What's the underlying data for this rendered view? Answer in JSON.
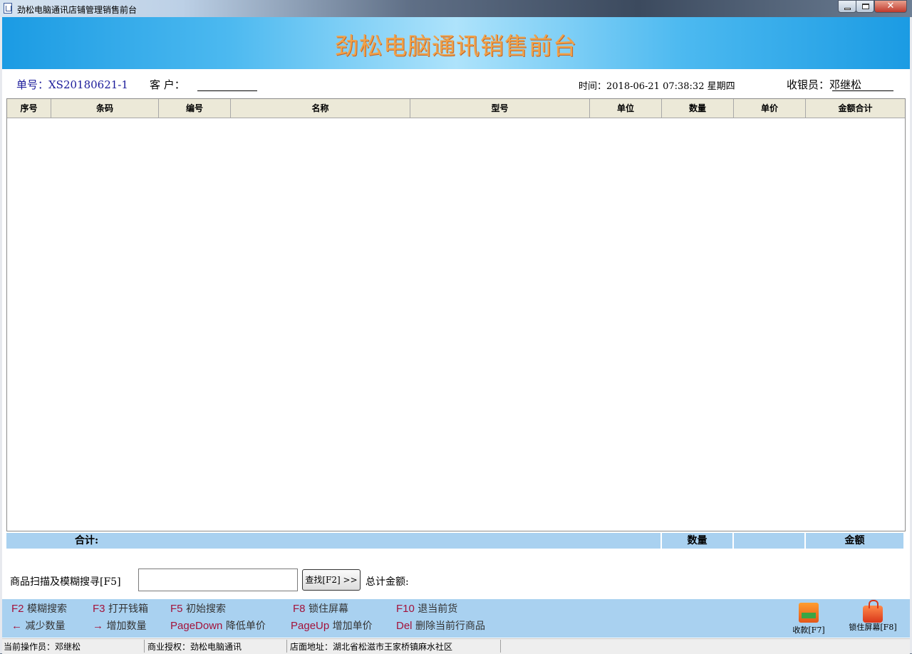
{
  "window": {
    "title": "劲松电脑通讯店铺管理销售前台",
    "close_glyph": "✕"
  },
  "header": {
    "heading": "劲松电脑通讯销售前台"
  },
  "info": {
    "order_no": "单号：XS20180621-1",
    "customer_label": "客 户：",
    "customer_value": "",
    "datetime": "时间：2018-06-21 07:38:32 星期四",
    "cashier": "收银员：邓继松"
  },
  "grid": {
    "columns": [
      "序号",
      "条码",
      "编号",
      "名称",
      "型号",
      "单位",
      "数量",
      "单价",
      "金额合计"
    ],
    "rows": []
  },
  "totals": {
    "label": "合计:",
    "quantity_label": "数量",
    "amount_label": "金额"
  },
  "search": {
    "label": "商品扫描及模糊搜寻[F5]",
    "value": "",
    "find_button": "查找[F2] >>",
    "grand_total_label": "总计金额:"
  },
  "hotkeys": {
    "row1": [
      {
        "key": "F2",
        "desc": "模糊搜索"
      },
      {
        "key": "F3",
        "desc": "打开钱箱"
      },
      {
        "key": "F5",
        "desc": "初始搜索"
      },
      {
        "key": "F8",
        "desc": "锁住屏幕"
      },
      {
        "key": "F10",
        "desc": "退当前货"
      }
    ],
    "row2": [
      {
        "key": "←",
        "desc": "减少数量"
      },
      {
        "key": "→",
        "desc": "增加数量"
      },
      {
        "key": "PageDown",
        "desc": "降低单价"
      },
      {
        "key": "PageUp",
        "desc": "增加单价"
      },
      {
        "key": "Del",
        "desc": "删除当前行商品"
      }
    ]
  },
  "actions": {
    "checkout": "收款[F7]",
    "lock_screen": "锁住屏幕[F8]"
  },
  "status": {
    "operator": "当前操作员：邓继松",
    "license": "商业授权：劲松电脑通讯",
    "address": "店面地址：湖北省松滋市王家桥镇麻水社区"
  },
  "colors": {
    "banner": "#1b9be3",
    "heading": "#f0a24a",
    "panel": "#a9d1f0",
    "hotkey": "#a3123a",
    "order_no": "#1a1a9a"
  },
  "icons": [
    "app-icon",
    "minimize-icon",
    "maximize-icon",
    "close-icon",
    "shopping-cart-icon",
    "lock-icon"
  ]
}
